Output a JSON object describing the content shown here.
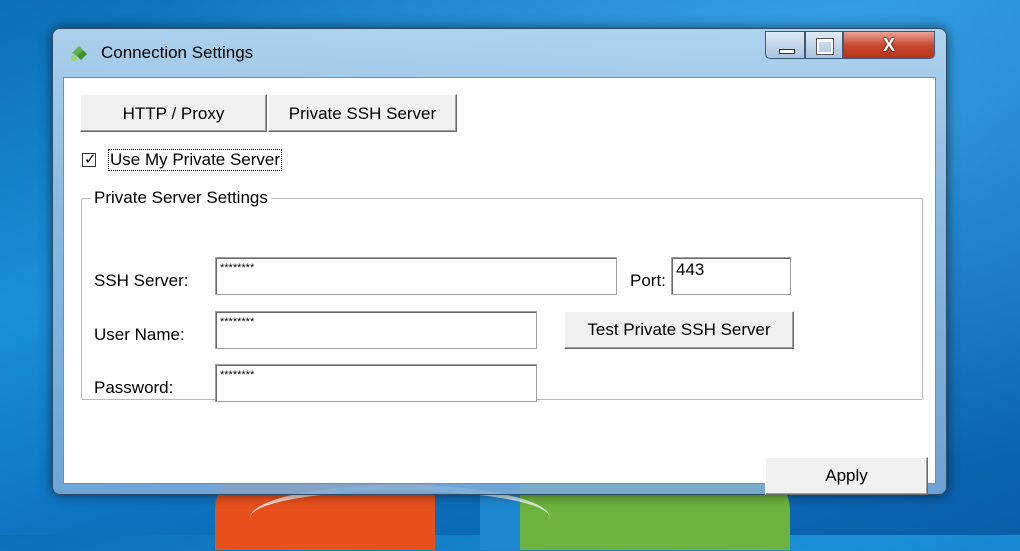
{
  "window": {
    "title": "Connection Settings"
  },
  "tabs": [
    {
      "label": "HTTP / Proxy"
    },
    {
      "label": "Private SSH Server"
    }
  ],
  "use_private_server": {
    "label": "Use My Private Server",
    "checked": true,
    "mark": "✓"
  },
  "private_settings": {
    "group_title": "Private Server Settings",
    "ssh_server": {
      "label": "SSH Server:",
      "value": "********"
    },
    "port": {
      "label": "Port:",
      "value": "443"
    },
    "user_name": {
      "label": "User Name:",
      "value": "********"
    },
    "password": {
      "label": "Password:",
      "value": "********"
    },
    "test_button": "Test Private SSH Server"
  },
  "apply_button": "Apply",
  "controls": {
    "close_glyph": "X"
  },
  "colors": {
    "close_red": "#c94a31",
    "desktop_blue": "#1a8fd8"
  }
}
